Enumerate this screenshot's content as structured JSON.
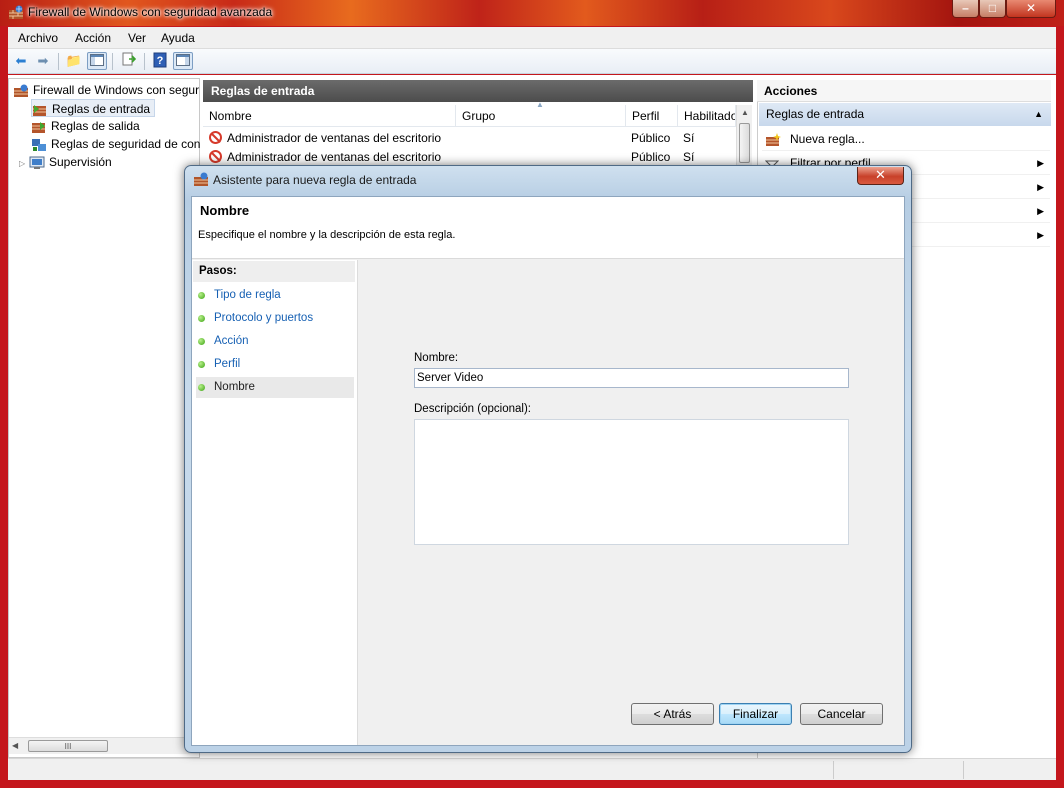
{
  "window": {
    "title": "Firewall de Windows con seguridad avanzada",
    "controls": [
      "–",
      "□",
      "✕"
    ]
  },
  "menu": [
    "Archivo",
    "Acción",
    "Ver",
    "Ayuda"
  ],
  "tree": {
    "root": "Firewall de Windows con segur",
    "items": [
      "Reglas de entrada",
      "Reglas de salida",
      "Reglas de seguridad de con",
      "Supervisión"
    ]
  },
  "scroll": {
    "thumb_grip": "III"
  },
  "middle": {
    "title": "Reglas de entrada",
    "columns": [
      "Nombre",
      "Grupo",
      "Perfil",
      "Habilitado"
    ],
    "rows": [
      {
        "name": "Administrador de ventanas del escritorio",
        "group": "",
        "profile": "Público",
        "enabled": "Sí"
      },
      {
        "name": "Administrador de ventanas del escritorio",
        "group": "",
        "profile": "Público",
        "enabled": "Sí"
      }
    ]
  },
  "actions": {
    "title": "Acciones",
    "section": "Reglas de entrada",
    "items": [
      "Nueva regla...",
      "Filtrar por perfil"
    ]
  },
  "dialog": {
    "title": "Asistente para nueva regla de entrada",
    "heading": "Nombre",
    "subheading": "Especifique el nombre y la descripción de esta regla.",
    "steps_label": "Pasos:",
    "steps": [
      "Tipo de regla",
      "Protocolo y puertos",
      "Acción",
      "Perfil",
      "Nombre"
    ],
    "active_step": "Nombre",
    "name_label": "Nombre:",
    "name_value": "Server Video",
    "desc_label": "Descripción (opcional):",
    "desc_value": "",
    "buttons": {
      "back": "< Atrás",
      "finish": "Finalizar",
      "cancel": "Cancelar"
    }
  }
}
